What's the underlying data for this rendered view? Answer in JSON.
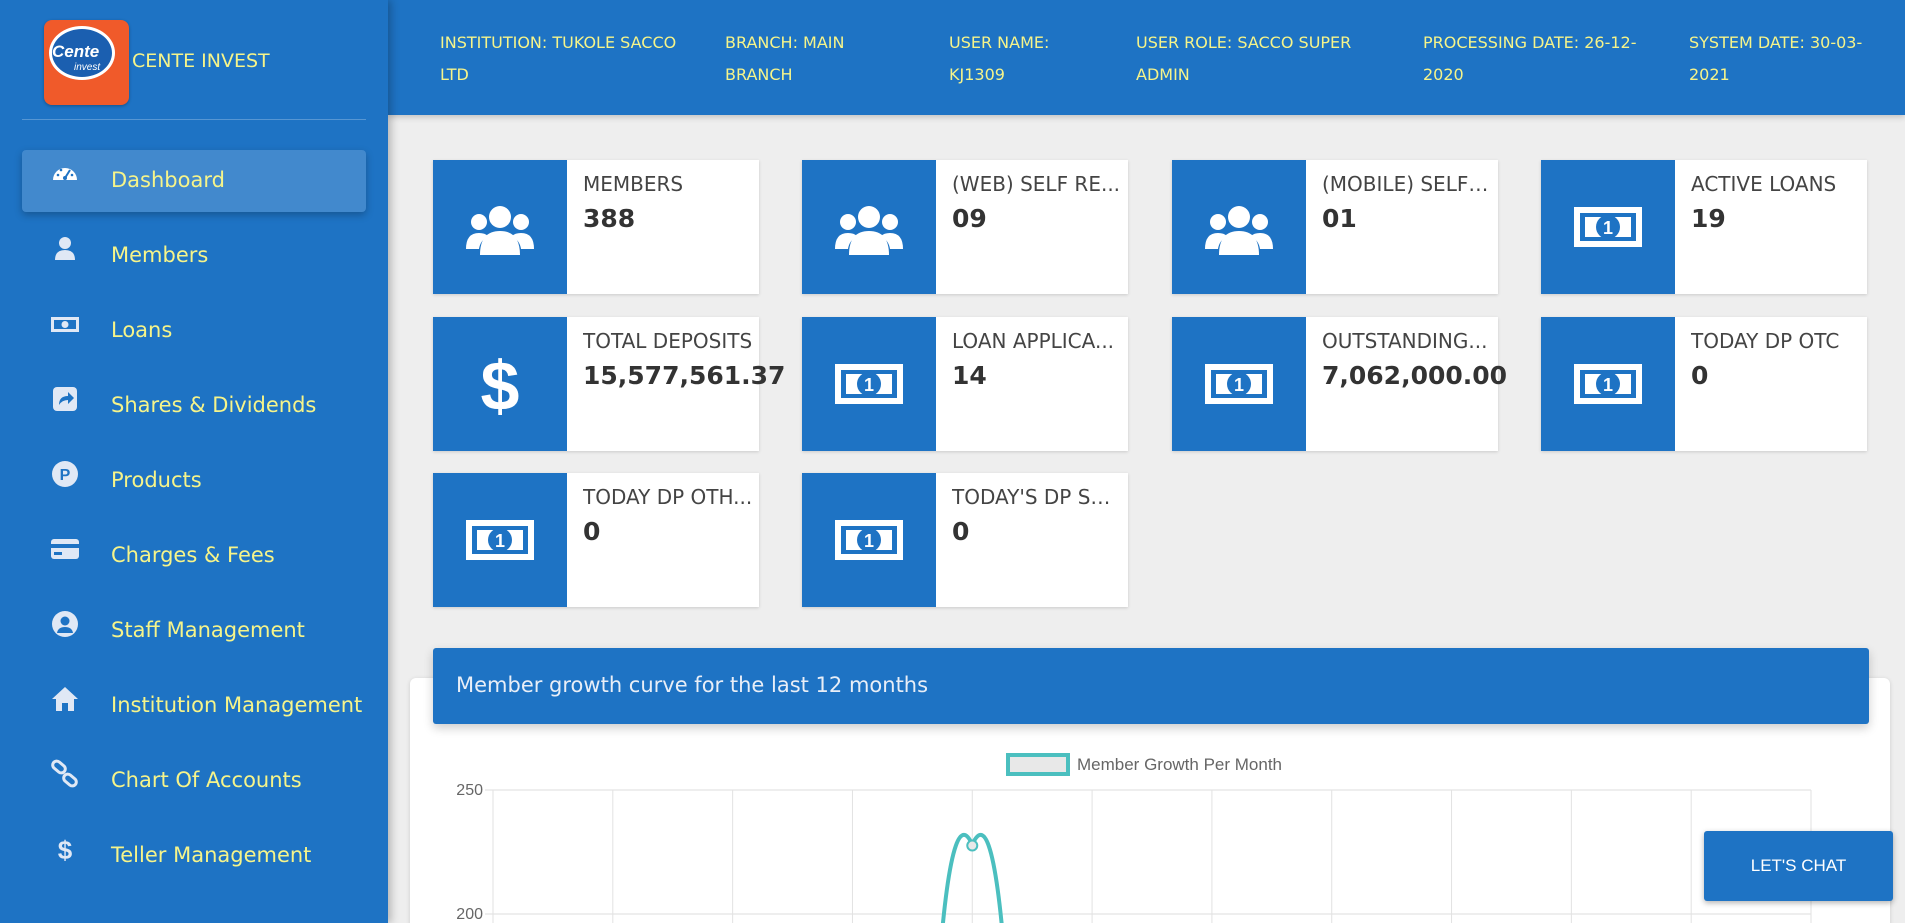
{
  "brand": {
    "name": "CENTE INVEST",
    "logo_text": "Cente",
    "logo_sub": "invest"
  },
  "sidebar": {
    "items": [
      {
        "label": "Dashboard",
        "icon": "dashboard-icon",
        "active": true
      },
      {
        "label": "Members",
        "icon": "user-icon"
      },
      {
        "label": "Loans",
        "icon": "money-icon"
      },
      {
        "label": "Shares & Dividends",
        "icon": "share-icon"
      },
      {
        "label": "Products",
        "icon": "product-icon"
      },
      {
        "label": "Charges & Fees",
        "icon": "credit-card-icon"
      },
      {
        "label": "Staff Management",
        "icon": "user-circle-icon"
      },
      {
        "label": "Institution Management",
        "icon": "home-icon"
      },
      {
        "label": "Chart Of Accounts",
        "icon": "link-icon"
      },
      {
        "label": "Teller Management",
        "icon": "dollar-icon"
      }
    ]
  },
  "header": {
    "institution": [
      "INSTITUTION: TUKOLE SACCO",
      "LTD"
    ],
    "branch": [
      "BRANCH: MAIN",
      "BRANCH"
    ],
    "user_name": [
      "USER NAME:",
      "KJ1309"
    ],
    "user_role": [
      "USER ROLE: SACCO SUPER",
      "ADMIN"
    ],
    "processing_date": [
      "PROCESSING DATE: 26-12-",
      "2020"
    ],
    "system_date": [
      "SYSTEM DATE: 30-03-",
      "2021"
    ]
  },
  "cards": [
    {
      "label": "MEMBERS",
      "value": "388",
      "icon": "users-icon"
    },
    {
      "label": "(WEB) SELF RE...",
      "value": "09",
      "icon": "users-icon"
    },
    {
      "label": "(MOBILE) SELF ...",
      "value": "01",
      "icon": "users-icon"
    },
    {
      "label": "ACTIVE LOANS",
      "value": "19",
      "icon": "money-icon"
    },
    {
      "label": "TOTAL DEPOSITS",
      "value": "15,577,561.37",
      "icon": "dollar-icon"
    },
    {
      "label": "LOAN APPLICA...",
      "value": "14",
      "icon": "money-icon"
    },
    {
      "label": "OUTSTANDING...",
      "value": "7,062,000.00",
      "icon": "money-icon"
    },
    {
      "label": "TODAY DP OTC",
      "value": "0",
      "icon": "money-icon"
    },
    {
      "label": "TODAY DP OTH...",
      "value": "0",
      "icon": "money-icon"
    },
    {
      "label": "TODAY'S DP SU...",
      "value": "0",
      "icon": "money-icon"
    }
  ],
  "panel": {
    "title": "Member growth curve for the last 12 months"
  },
  "chart_data": {
    "type": "line",
    "legend": "Member Growth Per Month",
    "y_ticks": [
      "250",
      "200"
    ],
    "ylim": [
      200,
      250
    ],
    "series": [
      {
        "name": "Member Growth Per Month",
        "color": "#4bbfbf",
        "peak_value": 228,
        "peak_index": 4
      }
    ],
    "grid": true
  },
  "chat": {
    "label": "LET'S CHAT"
  },
  "colors": {
    "primary": "#1e73c4",
    "accent_text": "#f6f48a",
    "line": "#4bbfbf"
  }
}
